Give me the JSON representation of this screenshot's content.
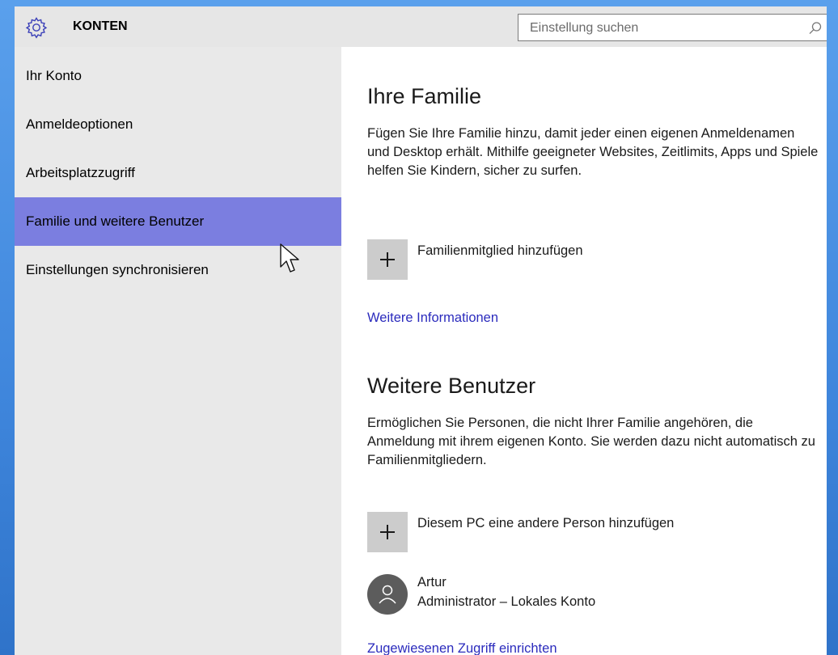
{
  "header": {
    "title": "KONTEN",
    "app_icon": "gear-icon",
    "search_placeholder": "Einstellung suchen",
    "search_icon": "search-icon"
  },
  "sidebar": {
    "items": [
      {
        "label": "Ihr Konto",
        "active": false
      },
      {
        "label": "Anmeldeoptionen",
        "active": false
      },
      {
        "label": "Arbeitsplatzzugriff",
        "active": false
      },
      {
        "label": "Familie und weitere Benutzer",
        "active": true
      },
      {
        "label": "Einstellungen synchronisieren",
        "active": false
      }
    ]
  },
  "main": {
    "family": {
      "heading": "Ihre Familie",
      "description": "Fügen Sie Ihre Familie hinzu, damit jeder einen eigenen Anmeldenamen und Desktop erhält. Mithilfe geeigneter Websites, Zeitlimits, Apps und Spiele helfen Sie Kindern, sicher zu surfen.",
      "add_label": "Familienmitglied hinzufügen",
      "link": "Weitere Informationen"
    },
    "others": {
      "heading": "Weitere Benutzer",
      "description": "Ermöglichen Sie Personen, die nicht Ihrer Familie angehören, die Anmeldung mit ihrem eigenen Konto. Sie werden dazu nicht automatisch zu Familienmitgliedern.",
      "add_label": "Diesem PC eine andere Person hinzufügen",
      "user": {
        "name": "Artur",
        "role": "Administrator – Lokales Konto"
      },
      "link": "Zugewiesenen Zugriff einrichten"
    }
  },
  "colors": {
    "active_nav": "#7b7ee0",
    "link": "#2b2bbd",
    "sidebar_bg": "#e9e9e9",
    "desktop_bg": "#3f86dc"
  }
}
